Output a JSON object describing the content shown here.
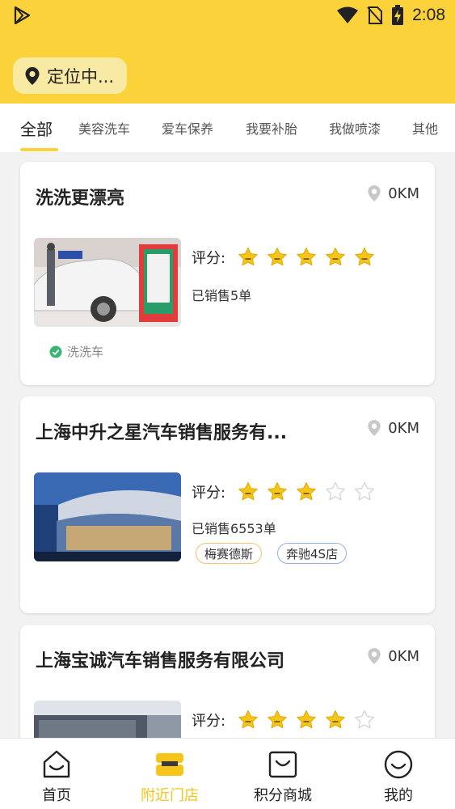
{
  "status_bar": {
    "time": "2:08"
  },
  "header": {
    "location_label": "定位中..."
  },
  "tabs": [
    {
      "label": "全部",
      "active": true
    },
    {
      "label": "美容洗车"
    },
    {
      "label": "爱车保养"
    },
    {
      "label": "我要补胎"
    },
    {
      "label": "我做喷漆"
    },
    {
      "label": "其他"
    }
  ],
  "shops": [
    {
      "name": "洗洗更漂亮",
      "distance": "0KM",
      "rating_label": "评分:",
      "stars": 5,
      "sold": "已销售5单",
      "service": "洗洗车",
      "tags": []
    },
    {
      "name": "上海中升之星汽车销售服务有...",
      "distance": "0KM",
      "rating_label": "评分:",
      "stars": 3,
      "sold": "已销售6553单",
      "tags": [
        "梅赛德斯",
        "奔驰4S店"
      ]
    },
    {
      "name": "上海宝诚汽车销售服务有限公司",
      "distance": "0KM",
      "rating_label": "评分:",
      "stars": 4
    }
  ],
  "bottom_nav": [
    {
      "label": "首页",
      "icon": "home-icon"
    },
    {
      "label": "附近门店",
      "icon": "store-icon",
      "active": true
    },
    {
      "label": "积分商城",
      "icon": "mall-icon"
    },
    {
      "label": "我的",
      "icon": "profile-icon"
    }
  ],
  "colors": {
    "accent": "#fcd23a",
    "active_nav": "#f5c518",
    "star": "#f5c518"
  }
}
